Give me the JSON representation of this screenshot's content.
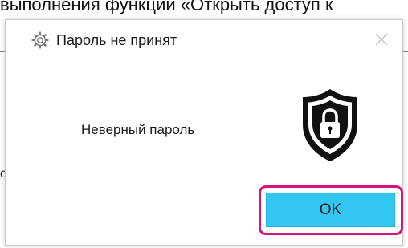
{
  "background": {
    "top_text": "выполнения функций «Открыть доступ к",
    "left_fragment": "о"
  },
  "dialog": {
    "title": "Пароль не принят",
    "message": "Неверный пароль",
    "ok_label": "OK",
    "icons": {
      "app": "settings-gear-icon",
      "close": "close-icon",
      "status": "shield-lock-icon"
    },
    "colors": {
      "ok_button": "#32c6f0",
      "highlight": "#d4167a"
    }
  }
}
